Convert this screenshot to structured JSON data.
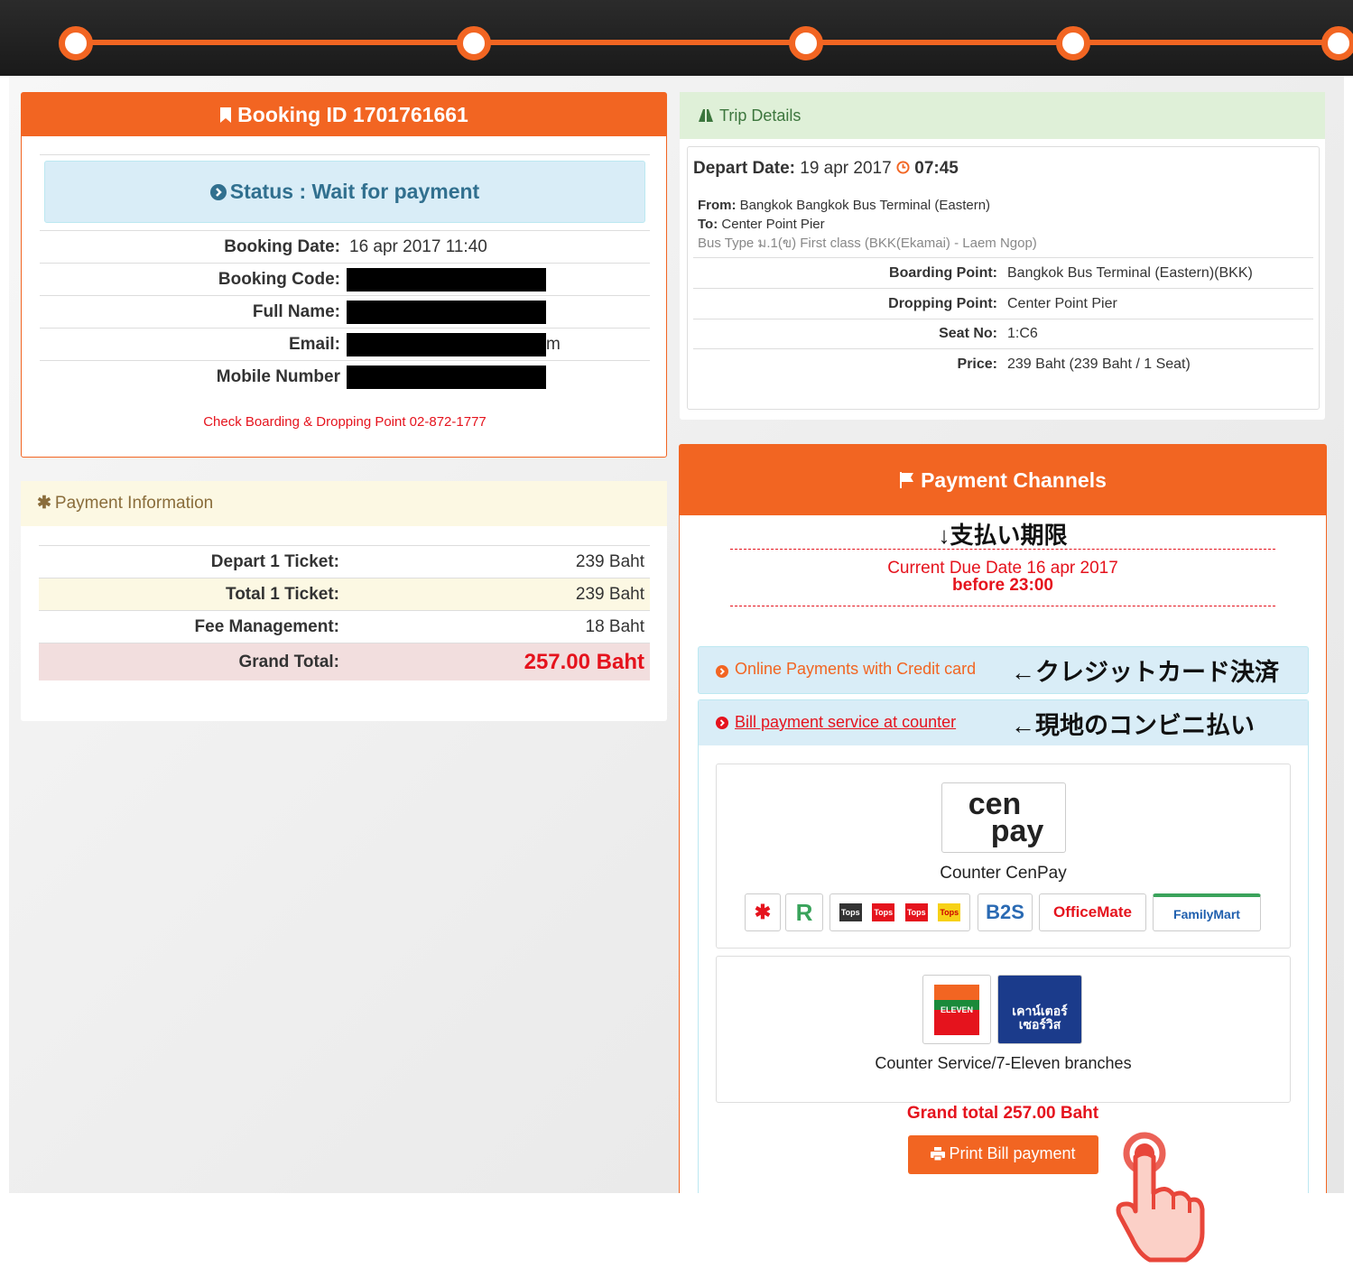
{
  "booking": {
    "header": "Booking ID 1701761661",
    "status": "Status : Wait for payment",
    "rows": [
      {
        "label": "Booking Date:",
        "value": "16 apr 2017 11:40"
      },
      {
        "label": "Booking Code:",
        "value": ""
      },
      {
        "label": "Full Name:",
        "value": ""
      },
      {
        "label": "Email:",
        "value": "m"
      },
      {
        "label": "Mobile Number",
        "value": ""
      }
    ],
    "note": "Check Boarding & Dropping Point 02-872-1777"
  },
  "payment_info": {
    "header": "Payment Information",
    "rows": [
      {
        "label": "Depart 1 Ticket:",
        "value": "239 Baht"
      },
      {
        "label": "Total 1 Ticket:",
        "value": "239 Baht"
      },
      {
        "label": "Fee Management:",
        "value": "18 Baht"
      },
      {
        "label": "Grand Total:",
        "value": "257.00 Baht"
      }
    ]
  },
  "trip": {
    "header": "Trip Details",
    "depart_label": "Depart Date:",
    "depart_date": "19 apr 2017",
    "depart_time": "07:45",
    "from_label": "From:",
    "from_value": "Bangkok Bangkok Bus Terminal (Eastern)",
    "to_label": "To:",
    "to_value": "Center Point Pier",
    "bus_type": "Bus Type ม.1(ข) First class (BKK(Ekamai) - Laem Ngop)",
    "rows": [
      {
        "label": "Boarding Point:",
        "value": "Bangkok Bus Terminal (Eastern)(BKK)"
      },
      {
        "label": "Dropping Point:",
        "value": "Center Point Pier"
      },
      {
        "label": "Seat No:",
        "value": "1:C6"
      },
      {
        "label": "Price:",
        "value": "239 Baht (239 Baht / 1 Seat)"
      }
    ]
  },
  "channels": {
    "header": "Payment Channels",
    "deadline_annotation": "↓支払い期限",
    "due_line1": "Current Due Date 16 apr 2017",
    "due_line2": "before 23:00",
    "online_label": "Online Payments with Credit card",
    "online_annotation": "←クレジットカード決済",
    "bill_label": "Bill payment service at counter",
    "bill_annotation": "←現地のコンビニ払い",
    "cenpay_logo_top": "cen",
    "cenpay_logo_bottom": "pay",
    "cenpay_caption": "Counter CenPay",
    "store_logos": [
      "R",
      "Tops",
      "Tops",
      "Tops",
      "Tops",
      "B2S",
      "OfficeMate",
      "FamilyMart"
    ],
    "seven_logo": "ELEVEN",
    "cs_logo": "เคาน์เตอร์ เซอร์วิส",
    "counter_caption": "Counter Service/7-Eleven branches",
    "grand_total": "Grand total 257.00 Baht",
    "print_button": "Print Bill payment"
  },
  "colors": {
    "accent": "#f26522",
    "status_bg": "#d9edf7",
    "status_text": "#31708f",
    "trip_head_bg": "#dff0d8",
    "info_head_bg": "#fcf8e3",
    "grand_row_bg": "#f2dede",
    "danger": "#e5131d"
  },
  "icons": [
    "bookmark-icon",
    "chevron-right-circle-icon",
    "road-icon",
    "clock-icon",
    "asterisk-icon",
    "flag-icon",
    "print-icon",
    "hand-pointer-icon"
  ]
}
